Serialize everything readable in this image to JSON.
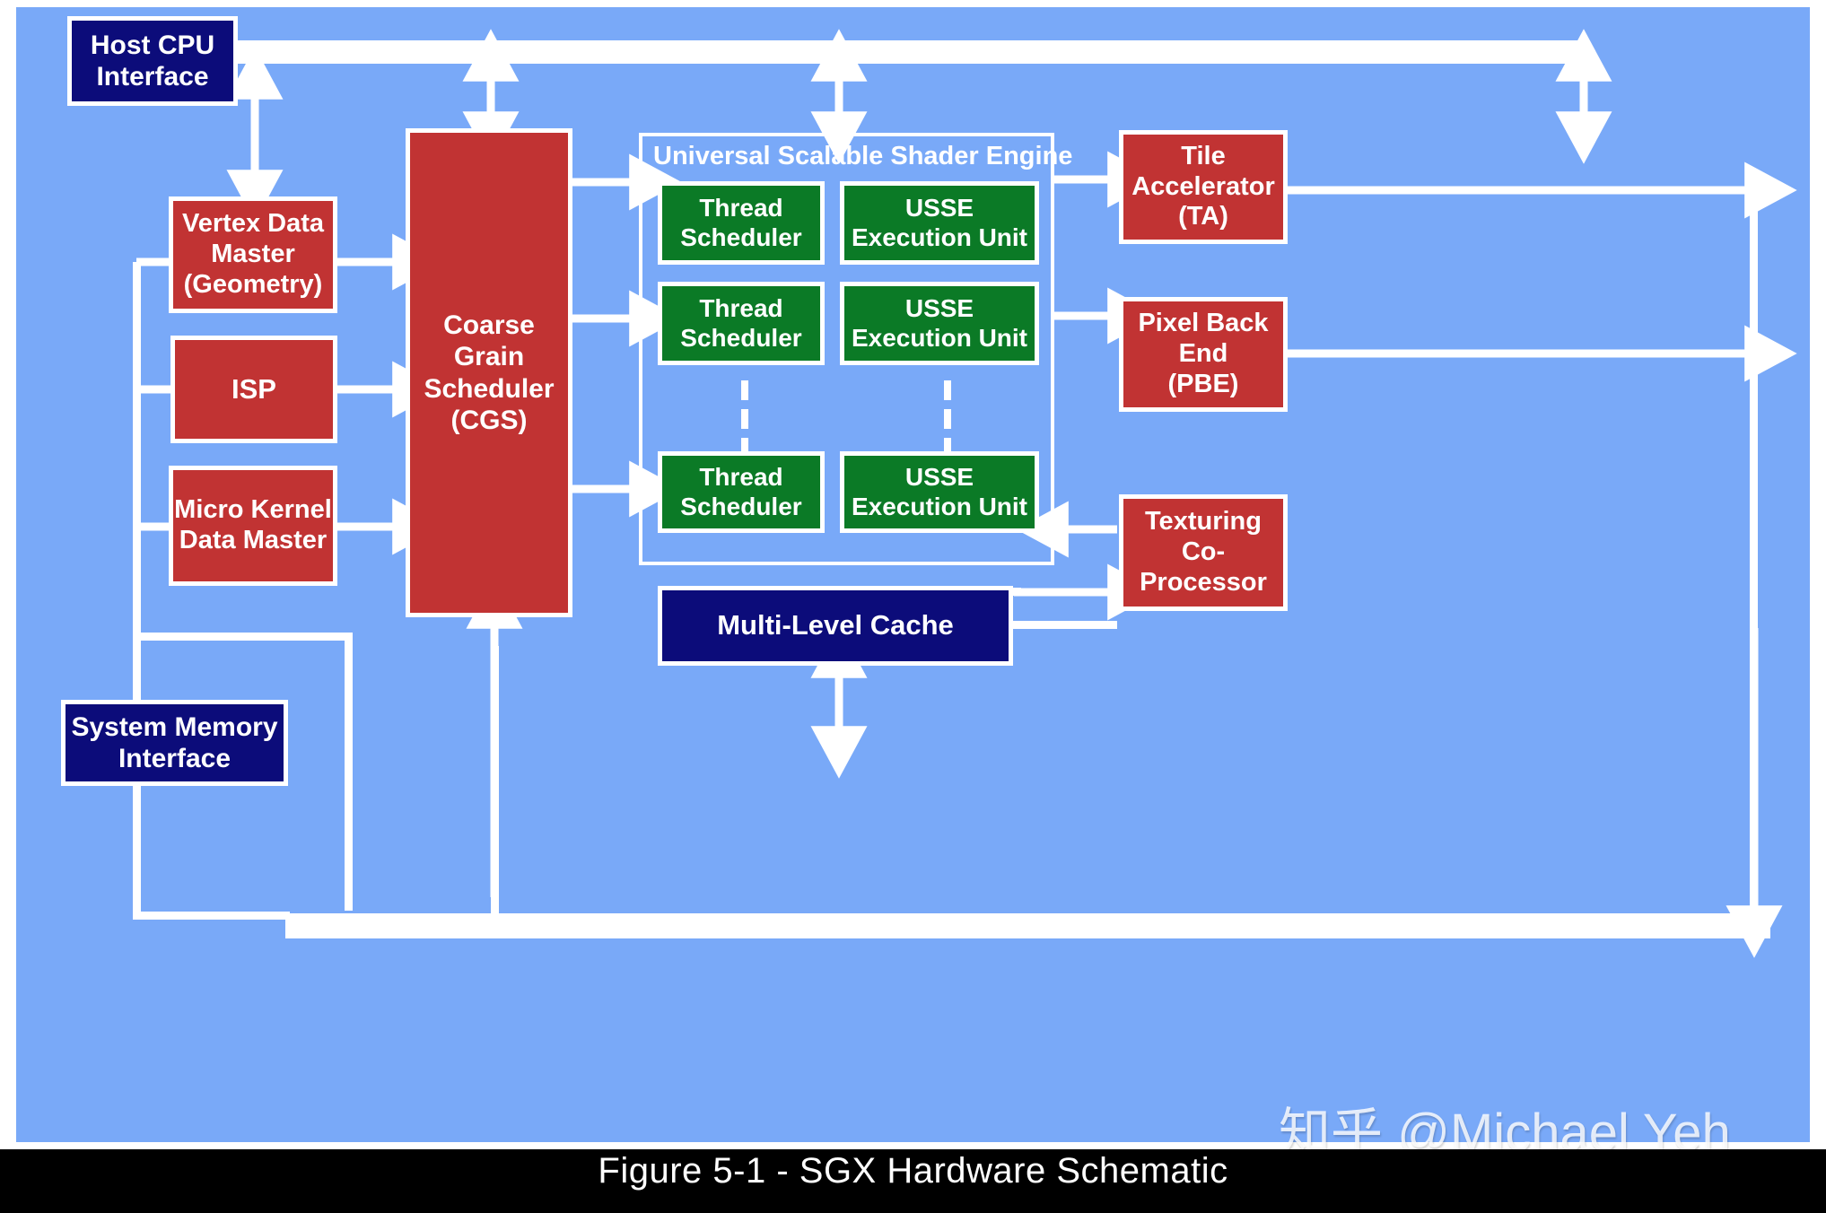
{
  "figure": {
    "caption": "Figure 5-1 - SGX Hardware Schematic",
    "watermark": "知乎 @Michael Yeh"
  },
  "colors": {
    "background": "#79A9F8",
    "red_block": "#C13333",
    "green_block": "#0B7A26",
    "navy_block": "#0C0C7A",
    "connector": "#ffffff",
    "caption_band": "#000000"
  },
  "diagram": {
    "title": "SGX Hardware Schematic",
    "group_label": "Universal Scalable Shader Engine",
    "nodes": {
      "host_cpu_interface": "Host CPU\nInterface",
      "vertex_data_master": "Vertex Data\nMaster\n(Geometry)",
      "isp": "ISP",
      "micro_kernel_data_master": "Micro Kernel\nData Master",
      "coarse_grain_scheduler": "Coarse\nGrain\nScheduler\n(CGS)",
      "thread_scheduler_1": "Thread\nScheduler",
      "thread_scheduler_2": "Thread\nScheduler",
      "thread_scheduler_n": "Thread\nScheduler",
      "usse_execution_unit_1": "USSE\nExecution Unit",
      "usse_execution_unit_2": "USSE\nExecution Unit",
      "usse_execution_unit_n": "USSE\nExecution Unit",
      "tile_accelerator": "Tile\nAccelerator\n(TA)",
      "pixel_back_end": "Pixel Back\nEnd\n(PBE)",
      "texturing_co_processor": "Texturing\nCo-\nProcessor",
      "multi_level_cache": "Multi-Level Cache",
      "system_memory_interface": "System Memory\nInterface"
    }
  }
}
